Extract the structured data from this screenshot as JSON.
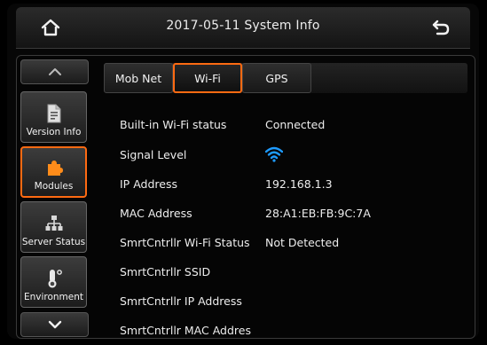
{
  "header": {
    "title": "2017-05-11  System Info",
    "home_icon": "home-icon",
    "back_icon": "back-arrow-icon"
  },
  "sidebar": {
    "up_icon": "chevron-up-icon",
    "down_icon": "chevron-down-icon",
    "items": [
      {
        "label": "Version Info",
        "icon": "document-icon",
        "active": false
      },
      {
        "label": "Modules",
        "icon": "puzzle-icon",
        "active": true
      },
      {
        "label": "Server Status",
        "icon": "network-icon",
        "active": false
      },
      {
        "label": "Environment",
        "icon": "thermometer-icon",
        "active": false
      }
    ]
  },
  "tabs": [
    {
      "label": "Mob Net",
      "active": false
    },
    {
      "label": "Wi-Fi",
      "active": true
    },
    {
      "label": "GPS",
      "active": false
    }
  ],
  "wifi_info": {
    "rows": [
      {
        "label": "Built-in Wi-Fi status",
        "value": "Connected"
      },
      {
        "label": "Signal Level",
        "value": "",
        "icon": "wifi-signal-icon"
      },
      {
        "label": "IP Address",
        "value": "192.168.1.3"
      },
      {
        "label": "MAC Address",
        "value": "28:A1:EB:FB:9C:7A"
      },
      {
        "label": "SmrtCntrllr Wi-Fi Status",
        "value": "Not Detected"
      },
      {
        "label": "SmrtCntrllr SSID",
        "value": ""
      },
      {
        "label": "SmrtCntrllr IP Address",
        "value": ""
      },
      {
        "label": "SmrtCntrllr MAC Addres",
        "value": ""
      }
    ]
  },
  "colors": {
    "accent": "#ff6a12",
    "wifi_icon": "#1e9bff",
    "background": "#000000"
  }
}
